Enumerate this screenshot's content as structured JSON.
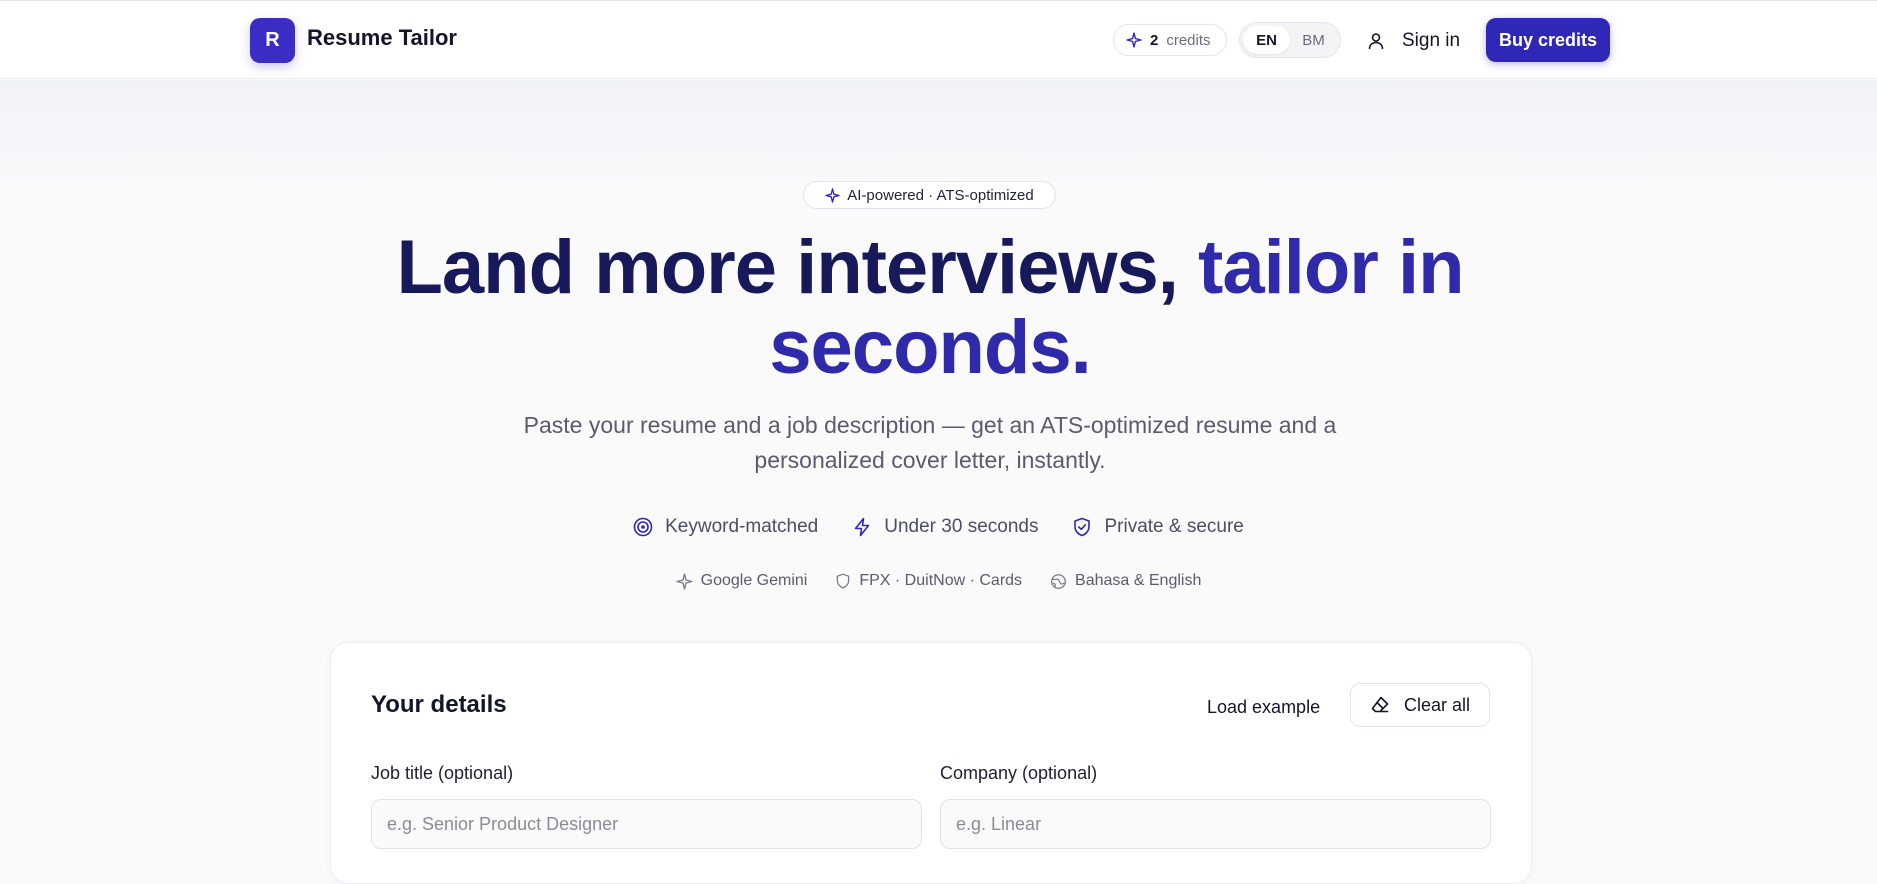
{
  "header": {
    "logo_letter": "R",
    "brand": "Resume Tailor",
    "credits_count": "2",
    "credits_label": "credits",
    "languages": [
      "EN",
      "BM"
    ],
    "active_language": "EN",
    "sign_in": "Sign in",
    "buy_credits": "Buy credits"
  },
  "hero": {
    "badge": "AI-powered · ATS-optimized",
    "title_main": "Land more interviews, ",
    "title_accent": "tailor in seconds.",
    "subtitle": "Paste your resume and a job description — get an ATS-optimized resume and a personalized cover letter, instantly.",
    "features": [
      {
        "label": "Keyword-matched",
        "icon": "target-icon"
      },
      {
        "label": "Under 30 seconds",
        "icon": "lightning-icon"
      },
      {
        "label": "Private & secure",
        "icon": "shield-check-icon"
      }
    ],
    "tech": [
      {
        "label": "Google Gemini",
        "icon": "sparkle-icon"
      },
      {
        "label": "FPX · DuitNow · Cards",
        "icon": "shield-icon"
      },
      {
        "label": "Bahasa & English",
        "icon": "globe-icon"
      }
    ]
  },
  "form": {
    "title": "Your details",
    "load_example": "Load example",
    "clear_all": "Clear all",
    "job_title_label": "Job title (optional)",
    "job_title_placeholder": "e.g. Senior Product Designer",
    "company_label": "Company (optional)",
    "company_placeholder": "e.g. Linear"
  },
  "colors": {
    "primary": "#2f27b8",
    "hero_dark": "#18195a",
    "hero_accent": "#2f2aaa"
  }
}
